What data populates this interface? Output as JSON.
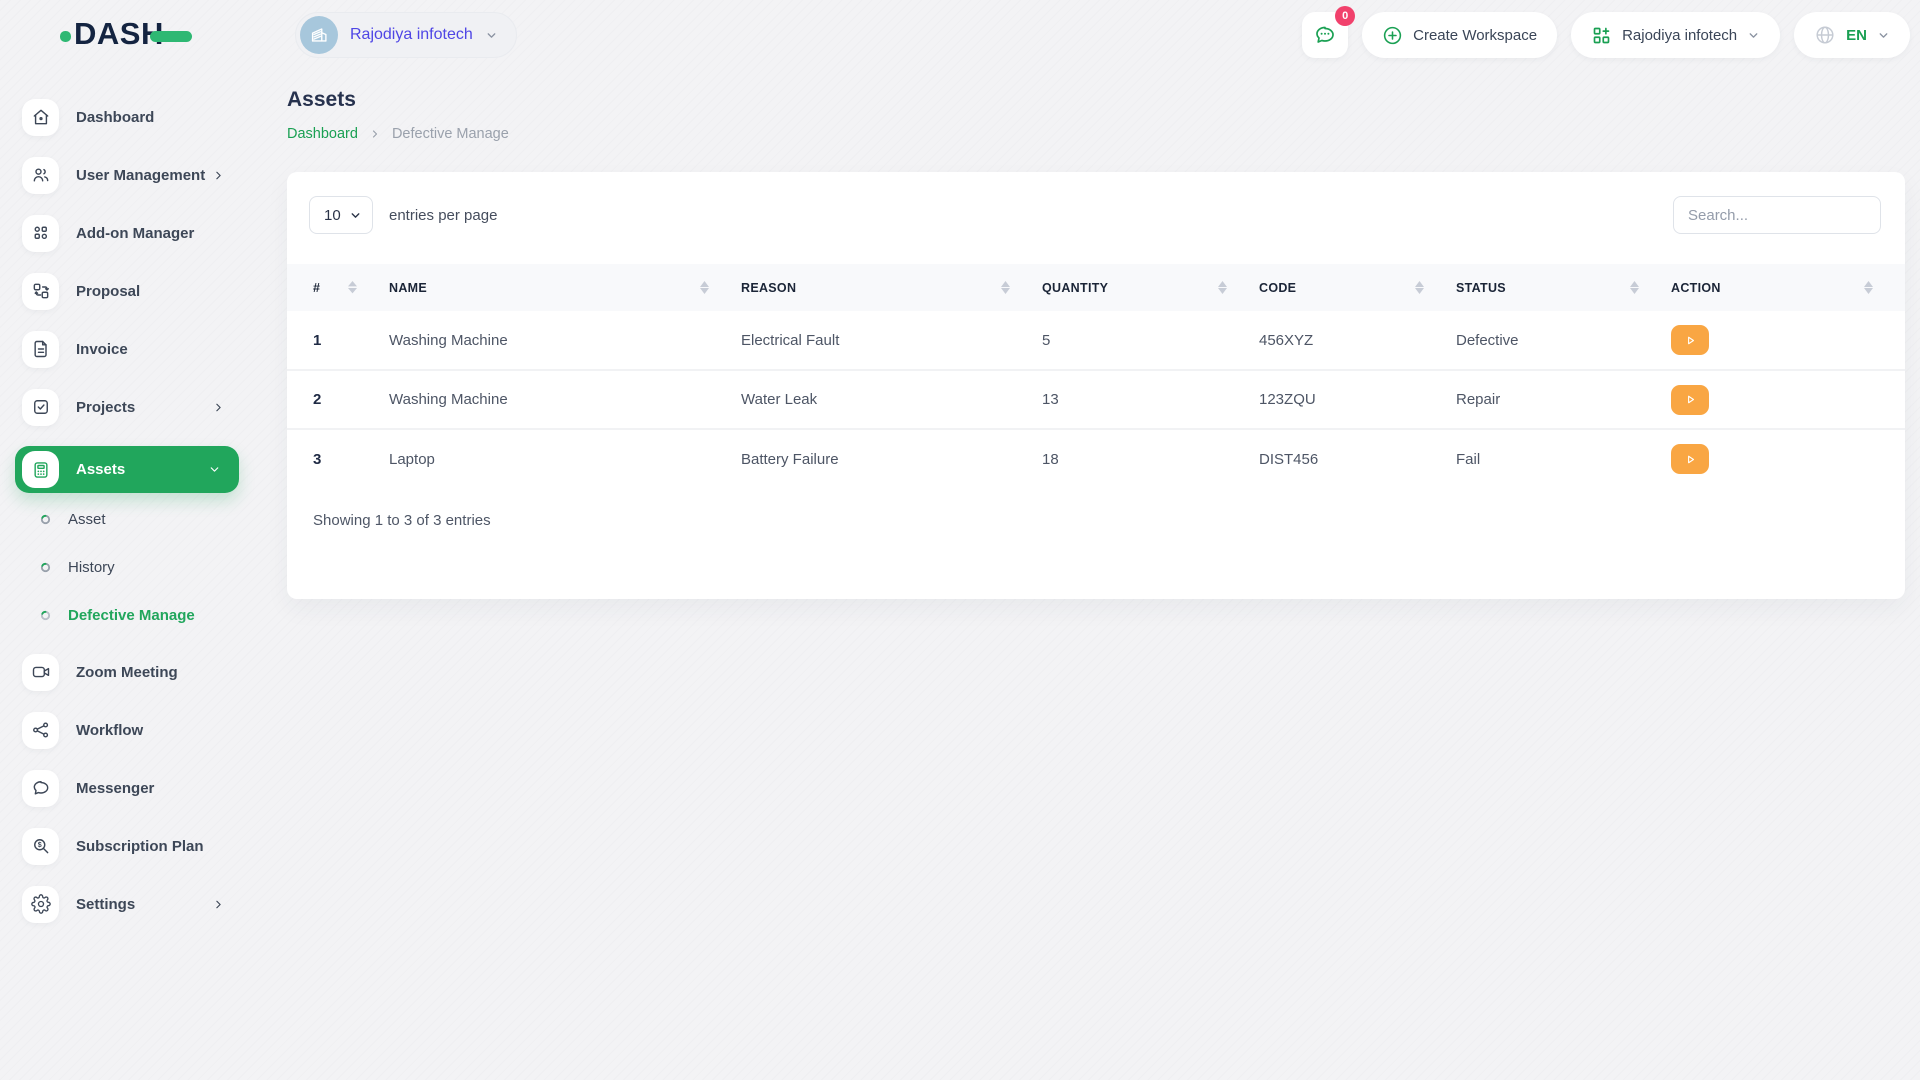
{
  "brand": {
    "name": "DASH"
  },
  "topbar": {
    "workspace_switcher": {
      "label": "Rajodiya infotech"
    },
    "notifications": {
      "badge": "0"
    },
    "create_workspace": {
      "label": "Create Workspace"
    },
    "company_menu": {
      "label": "Rajodiya infotech"
    },
    "language_menu": {
      "label": "EN"
    }
  },
  "sidebar": {
    "items": [
      {
        "label": "Dashboard"
      },
      {
        "label": "User Management"
      },
      {
        "label": "Add-on Manager"
      },
      {
        "label": "Proposal"
      },
      {
        "label": "Invoice"
      },
      {
        "label": "Projects"
      },
      {
        "label": "Assets"
      },
      {
        "label": "Zoom Meeting"
      },
      {
        "label": "Workflow"
      },
      {
        "label": "Messenger"
      },
      {
        "label": "Subscription Plan"
      },
      {
        "label": "Settings"
      }
    ],
    "assets_children": [
      {
        "label": "Asset"
      },
      {
        "label": "History"
      },
      {
        "label": "Defective Manage"
      }
    ],
    "active_item": "Assets",
    "active_sub_item": "Defective Manage"
  },
  "page": {
    "title": "Assets",
    "breadcrumb": {
      "home": "Dashboard",
      "current": "Defective Manage"
    }
  },
  "table_card": {
    "entries_per_page": {
      "selected": "10",
      "label": "entries per page"
    },
    "search": {
      "placeholder": "Search..."
    },
    "columns": [
      "#",
      "NAME",
      "REASON",
      "QUANTITY",
      "CODE",
      "STATUS",
      "ACTION"
    ],
    "rows": [
      {
        "index": "1",
        "name": "Washing Machine",
        "reason": "Electrical Fault",
        "quantity": "5",
        "code": "456XYZ",
        "status": "Defective"
      },
      {
        "index": "2",
        "name": "Washing Machine",
        "reason": "Water Leak",
        "quantity": "13",
        "code": "123ZQU",
        "status": "Repair"
      },
      {
        "index": "3",
        "name": "Laptop",
        "reason": "Battery Failure",
        "quantity": "18",
        "code": "DIST456",
        "status": "Fail"
      }
    ],
    "footer": {
      "summary": "Showing 1 to 3 of 3 entries"
    }
  },
  "colors": {
    "primary_green": "#21a65c",
    "brand_green": "#2eb873",
    "accent_orange": "#f9a643",
    "badge_pink": "#f1416c",
    "workspace_text_indigo": "#4f46e5",
    "dark_navy": "#142441"
  }
}
